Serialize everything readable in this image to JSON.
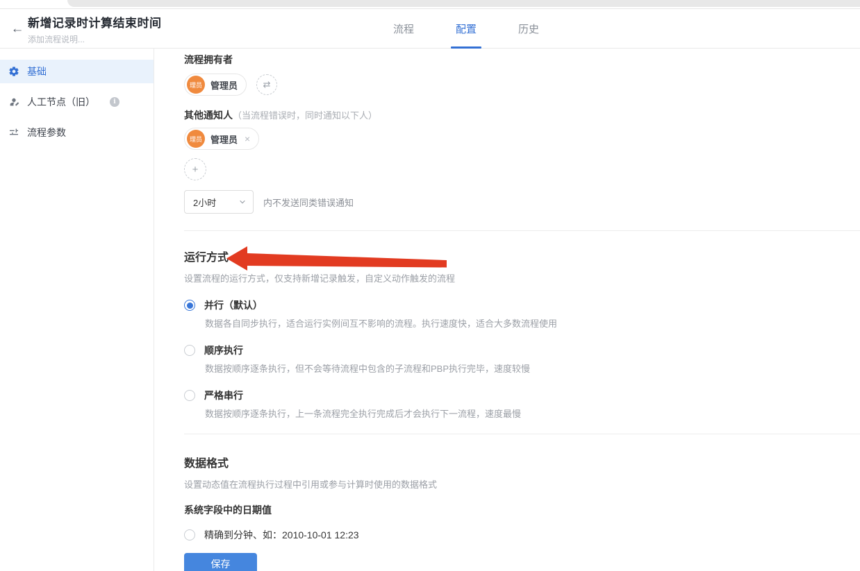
{
  "header": {
    "back_icon": "←",
    "title": "新增记录时计算结束时间",
    "subtitle": "添加流程说明...",
    "tabs": [
      {
        "label": "流程",
        "active": false
      },
      {
        "label": "配置",
        "active": true
      },
      {
        "label": "历史",
        "active": false
      }
    ]
  },
  "sidebar": {
    "items": [
      {
        "icon": "gear-icon",
        "label": "基础",
        "active": true
      },
      {
        "icon": "person-icon",
        "label": "人工节点（旧）",
        "info_icon": "i"
      },
      {
        "icon": "sliders-icon",
        "label": "流程参数"
      }
    ]
  },
  "main": {
    "owner": {
      "label": "流程拥有者",
      "member": {
        "avatar_text": "理员",
        "name": "管理员"
      },
      "swap_icon": "⇄"
    },
    "notify": {
      "label": "其他通知人",
      "hint": "（当流程错误时，同时通知以下人）",
      "member": {
        "avatar_text": "理员",
        "name": "管理员",
        "remove_icon": "×"
      },
      "add_icon": "+"
    },
    "error_notice": {
      "select_value": "2小时",
      "suffix": "内不发送同类错误通知"
    },
    "run_mode": {
      "title": "运行方式",
      "desc": "设置流程的运行方式，仅支持新增记录触发，自定义动作触发的流程",
      "options": [
        {
          "label": "并行（默认）",
          "desc": "数据各自同步执行，适合运行实例间互不影响的流程。执行速度快，适合大多数流程使用",
          "selected": true
        },
        {
          "label": "顺序执行",
          "desc": "数据按顺序逐条执行，但不会等待流程中包含的子流程和PBP执行完毕，速度较慢",
          "selected": false
        },
        {
          "label": "严格串行",
          "desc": "数据按顺序逐条执行，上一条流程完全执行完成后才会执行下一流程，速度最慢",
          "selected": false
        }
      ]
    },
    "data_format": {
      "title": "数据格式",
      "desc": "设置动态值在流程执行过程中引用或参与计算时使用的数据格式",
      "field_label": "系统字段中的日期值",
      "option": {
        "label": "精确到分钟、如：2010-10-01 12:23",
        "selected": false
      }
    },
    "save_label": "保存"
  },
  "annotation": {
    "shape": "red-arrow",
    "points_at": "运行方式",
    "color": "#e23b21"
  },
  "colors": {
    "accent_blue": "#3370d4",
    "avatar_orange": "#f08a3e",
    "save_blue": "#4586de",
    "arrow_red": "#e23b21",
    "active_item_bg": "#e9f2fc"
  }
}
